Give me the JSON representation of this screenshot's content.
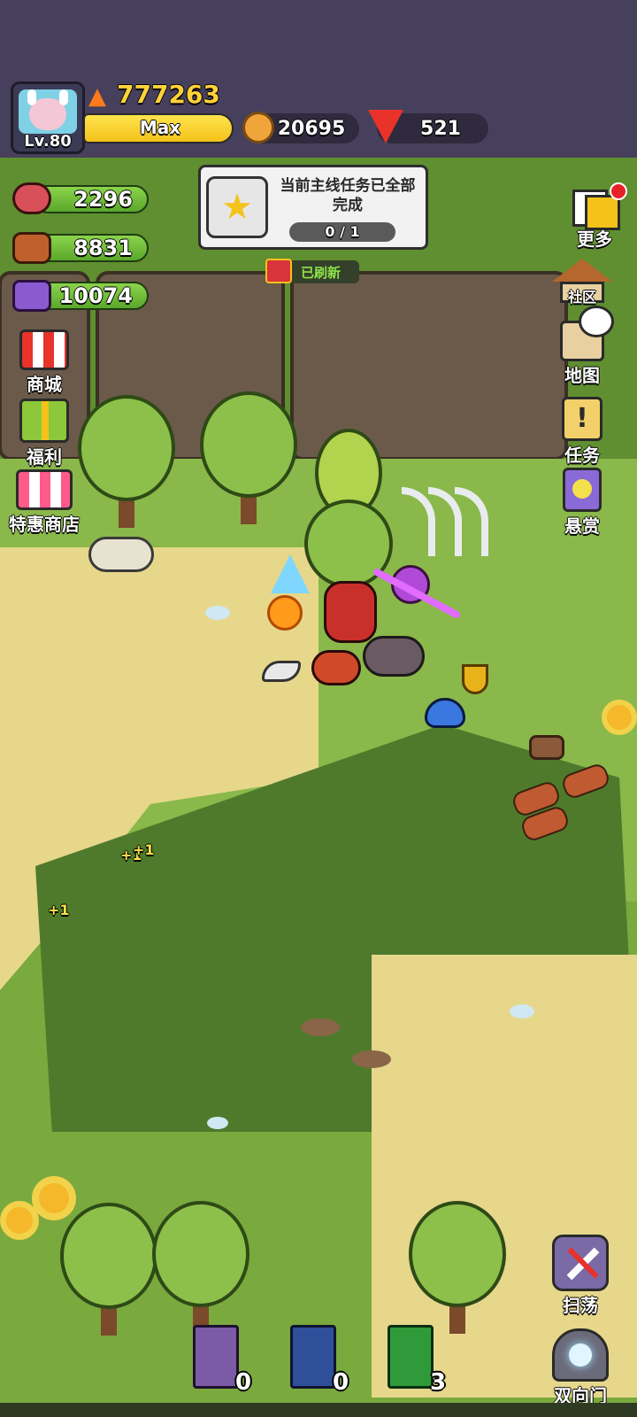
{
  "player": {
    "level": "Lv.80",
    "power": "777263",
    "name": "Max"
  },
  "currency": {
    "coins": "20695",
    "gems": "521"
  },
  "resources": {
    "meat": "2296",
    "wood": "8831",
    "ore": "10074"
  },
  "quest": {
    "text": "当前主线任务已全部完成",
    "progress": "0 / 1",
    "refresh": "已刷新"
  },
  "left_menu": {
    "shop": "商城",
    "welfare": "福利",
    "special_shop": "特惠商店"
  },
  "right_menu": {
    "more": "更多",
    "community": "社区",
    "map": "地图",
    "tasks": "任务",
    "bounty": "悬赏",
    "sweep": "扫荡",
    "portal": "双向门"
  },
  "floating_text": {
    "plus_a": "+1",
    "plus_b": "+1",
    "plus_c": "+1"
  },
  "books": [
    {
      "color": "#7b5aa6",
      "count": "0"
    },
    {
      "color": "#2f4f9a",
      "count": "0"
    },
    {
      "color": "#2f9a3a",
      "count": "3"
    }
  ],
  "colors": {
    "topbar": "#47405c",
    "grass": "#6f9a36",
    "sand": "#e6d78b",
    "dirt": "#6b5a4a"
  }
}
